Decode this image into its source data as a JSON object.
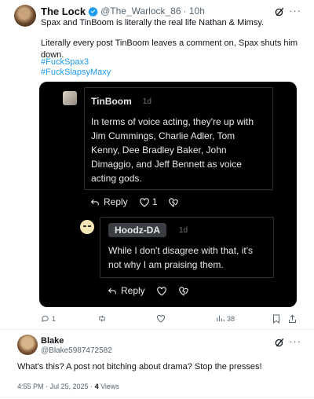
{
  "post": {
    "author_name": "The Lock",
    "author_handle": "@The_Warlock_86",
    "time": "· 10h",
    "line1": "Spax and TinBoom is literally the real life Nathan & Mimsy.",
    "line2": "Literally every post TinBoom leaves a comment on, Spax shuts him down.",
    "hashtags": [
      "#FuckSpax3",
      "#FuckSlapsyMaxy"
    ],
    "screenshot": {
      "comment1": {
        "name": "TinBoom",
        "time": "1d",
        "text_lines": [
          "In terms of voice acting, they're up with",
          "Jim Cummings, Charlie Adler, Tom",
          "Kenny, Dee Bradley Baker, John",
          "Dimaggio, and Jeff Bennett as voice",
          "acting gods."
        ],
        "reply_label": "Reply",
        "like_count": "1"
      },
      "comment2": {
        "name": "Hoodz-DA",
        "time": "1d",
        "text_lines": [
          "While I don't disagree with that, it's",
          "not why I am praising them."
        ],
        "reply_label": "Reply"
      }
    },
    "actions": {
      "replies": "1",
      "views": "38"
    }
  },
  "reply": {
    "author_name": "Blake",
    "author_handle": "@Blake5987472582",
    "text": "What's this? A post not bitching about drama? Stop the presses!",
    "timestamp": "4:55 PM · Jul 25, 2025 · ",
    "views_count": "4",
    "views_label": " Views"
  },
  "colors": {
    "accent": "#1d9bf0",
    "verified": "#1d9bf0",
    "dark_card": "#000000"
  }
}
